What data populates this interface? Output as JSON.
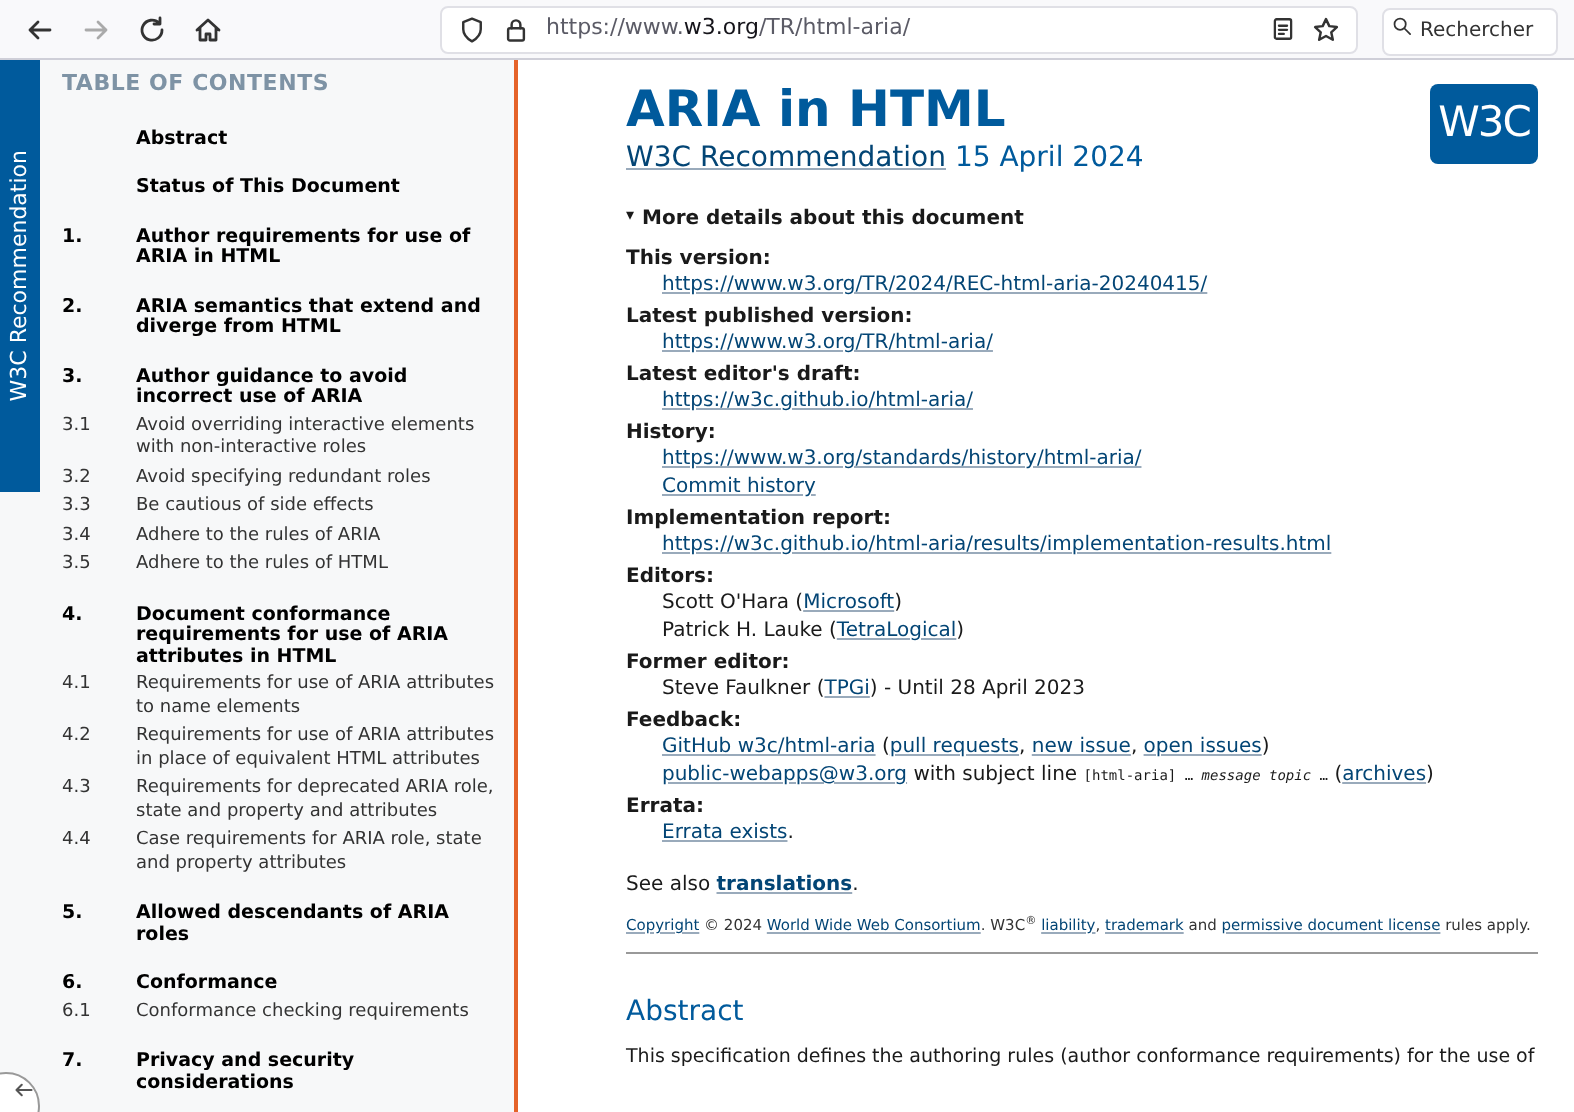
{
  "browser": {
    "url": [
      {
        "kind": "dim",
        "text": "https://www."
      },
      {
        "kind": "host",
        "text": "w3.org"
      },
      {
        "kind": "dim",
        "text": "/TR/html-aria/"
      }
    ],
    "search_placeholder": "Rechercher",
    "back_enabled": true,
    "forward_enabled": false
  },
  "side_tab": "W3C Recommendation",
  "toc": {
    "heading": "TABLE OF CONTENTS",
    "items": [
      {
        "kind": "section",
        "title": "Abstract"
      },
      {
        "kind": "section",
        "title": "Status of This Document"
      },
      {
        "kind": "section",
        "number": "1.",
        "title": "Author requirements for use of ARIA in HTML"
      },
      {
        "kind": "section",
        "number": "2.",
        "title": "ARIA semantics that extend and diverge from HTML"
      },
      {
        "kind": "section",
        "number": "3.",
        "title": "Author guidance to avoid incorrect use of ARIA"
      },
      {
        "kind": "sub",
        "number": "3.1",
        "title": "Avoid overriding interactive elements with non-interactive roles"
      },
      {
        "kind": "sub",
        "number": "3.2",
        "title": "Avoid specifying redundant roles"
      },
      {
        "kind": "sub",
        "number": "3.3",
        "title": "Be cautious of side effects"
      },
      {
        "kind": "sub",
        "number": "3.4",
        "title": "Adhere to the rules of ARIA"
      },
      {
        "kind": "sub",
        "number": "3.5",
        "title": "Adhere to the rules of HTML"
      },
      {
        "kind": "section",
        "number": "4.",
        "title": "Document conformance requirements for use of ARIA attributes in HTML"
      },
      {
        "kind": "sub",
        "number": "4.1",
        "title": "Requirements for use of ARIA attributes to name elements"
      },
      {
        "kind": "sub",
        "number": "4.2",
        "title": "Requirements for use of ARIA attributes in place of equivalent HTML attributes"
      },
      {
        "kind": "sub",
        "number": "4.3",
        "title": "Requirements for deprecated ARIA role, state and property and attributes"
      },
      {
        "kind": "sub",
        "number": "4.4",
        "title": "Case requirements for ARIA role, state and property attributes"
      },
      {
        "kind": "section",
        "number": "5.",
        "title": "Allowed descendants of ARIA roles"
      },
      {
        "kind": "section",
        "number": "6.",
        "title": "Conformance"
      },
      {
        "kind": "sub",
        "number": "6.1",
        "title": "Conformance checking requirements"
      },
      {
        "kind": "section",
        "number": "7.",
        "title": "Privacy and security considerations"
      }
    ]
  },
  "main": {
    "title": "ARIA in HTML",
    "subtitle": [
      {
        "kind": "link",
        "text": "W3C Recommendation"
      },
      {
        "kind": "text",
        "text": " 15 April 2024"
      }
    ],
    "logo": "W3C",
    "details": {
      "marker": "▾",
      "summary": "More details about this document",
      "expanded": true,
      "entries": [
        {
          "label": "This version:",
          "lines": [
            [
              {
                "kind": "link",
                "text": "https://www.w3.org/TR/2024/REC-html-aria-20240415/"
              }
            ]
          ]
        },
        {
          "label": "Latest published version:",
          "lines": [
            [
              {
                "kind": "link",
                "text": "https://www.w3.org/TR/html-aria/"
              }
            ]
          ]
        },
        {
          "label": "Latest editor's draft:",
          "lines": [
            [
              {
                "kind": "link",
                "text": "https://w3c.github.io/html-aria/"
              }
            ]
          ]
        },
        {
          "label": "History:",
          "lines": [
            [
              {
                "kind": "link",
                "text": "https://www.w3.org/standards/history/html-aria/"
              }
            ],
            [
              {
                "kind": "link",
                "text": "Commit history"
              }
            ]
          ]
        },
        {
          "label": "Implementation report:",
          "lines": [
            [
              {
                "kind": "link",
                "text": "https://w3c.github.io/html-aria/results/implementation-results.html"
              }
            ]
          ]
        },
        {
          "label": "Editors:",
          "lines": [
            [
              {
                "kind": "text",
                "text": "Scott O'Hara ("
              },
              {
                "kind": "link",
                "text": "Microsoft"
              },
              {
                "kind": "text",
                "text": ")"
              }
            ],
            [
              {
                "kind": "text",
                "text": "Patrick H. Lauke ("
              },
              {
                "kind": "link",
                "text": "TetraLogical"
              },
              {
                "kind": "text",
                "text": ")"
              }
            ]
          ]
        },
        {
          "label": "Former editor:",
          "lines": [
            [
              {
                "kind": "text",
                "text": "Steve Faulkner ("
              },
              {
                "kind": "link",
                "text": "TPGi"
              },
              {
                "kind": "text",
                "text": ") - Until 28 April 2023"
              }
            ]
          ]
        },
        {
          "label": "Feedback:",
          "lines": [
            [
              {
                "kind": "link",
                "text": "GitHub w3c/html-aria"
              },
              {
                "kind": "text",
                "text": " ("
              },
              {
                "kind": "link",
                "text": "pull requests"
              },
              {
                "kind": "text",
                "text": ", "
              },
              {
                "kind": "link",
                "text": "new issue"
              },
              {
                "kind": "text",
                "text": ", "
              },
              {
                "kind": "link",
                "text": "open issues"
              },
              {
                "kind": "text",
                "text": ")"
              }
            ],
            [
              {
                "kind": "link",
                "text": "public-webapps@w3.org"
              },
              {
                "kind": "text",
                "text": " with subject line "
              },
              {
                "kind": "code",
                "text": "[html-aria] … "
              },
              {
                "kind": "em_code",
                "text": "message topic"
              },
              {
                "kind": "code",
                "text": " …"
              },
              {
                "kind": "text",
                "text": " ("
              },
              {
                "kind": "link",
                "text": "archives"
              },
              {
                "kind": "text",
                "text": ")"
              }
            ]
          ]
        },
        {
          "label": "Errata:",
          "lines": [
            [
              {
                "kind": "link",
                "text": "Errata exists"
              },
              {
                "kind": "text",
                "text": "."
              }
            ]
          ]
        }
      ]
    },
    "see_also": [
      {
        "kind": "text",
        "text": "See also "
      },
      {
        "kind": "strong_link",
        "text": "translations"
      },
      {
        "kind": "text",
        "text": "."
      }
    ],
    "copyright": [
      {
        "kind": "link",
        "text": "Copyright"
      },
      {
        "kind": "text",
        "text": " © 2024 "
      },
      {
        "kind": "link",
        "text": "World Wide Web Consortium"
      },
      {
        "kind": "text",
        "text": ". "
      },
      {
        "kind": "rich",
        "text": "W3C$^{®}$ "
      },
      {
        "kind": "link",
        "text": "liability"
      },
      {
        "kind": "text",
        "text": ", "
      },
      {
        "kind": "link",
        "text": "trademark"
      },
      {
        "kind": "text",
        "text": " and "
      },
      {
        "kind": "link",
        "text": "permissive document license"
      },
      {
        "kind": "text",
        "text": " rules apply."
      }
    ],
    "abstract_heading": "Abstract",
    "abstract_text": "This specification defines the authoring rules (author conformance requirements) for the use of"
  }
}
